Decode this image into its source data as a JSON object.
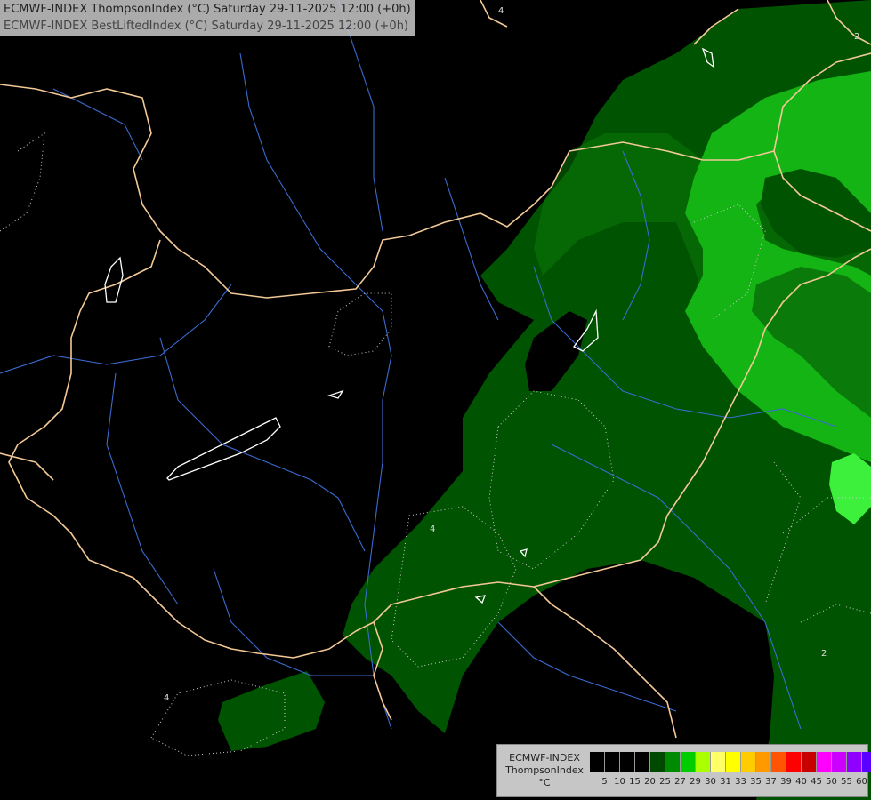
{
  "title": {
    "line1": "ECMWF-INDEX ThompsonIndex (°C) Saturday 29-11-2025 12:00 (+0h)",
    "line2": "ECMWF-INDEX BestLiftedIndex (°C) Saturday 29-11-2025 12:00 (+0h)"
  },
  "legend": {
    "label_lines": [
      "ECMWF-INDEX",
      "ThompsonIndex",
      "°C"
    ],
    "ticks": [
      "5",
      "10",
      "15",
      "20",
      "25",
      "27",
      "29",
      "30",
      "31",
      "33",
      "35",
      "37",
      "39",
      "40",
      "45",
      "50",
      "55",
      "60"
    ],
    "colors": [
      "#000000",
      "#000000",
      "#000000",
      "#000000",
      "#004a00",
      "#008a00",
      "#00cc00",
      "#aaff00",
      "#ffff66",
      "#ffff00",
      "#ffcc00",
      "#ff9900",
      "#ff5500",
      "#ff0000",
      "#c80000",
      "#ff00ff",
      "#cc00ff",
      "#9000ff",
      "#5a00ff",
      "#0000ff"
    ]
  },
  "contour_labels": {
    "top": "4",
    "top_right": "2",
    "center": "4",
    "bottom_right": "2",
    "bottom_left": "4"
  },
  "colors": {
    "dark_green": "#005300",
    "mid_green": "#0a7a0a",
    "bright_green": "#14b414",
    "lime": "#3cf03c",
    "borders": "#f2c896",
    "rivers": "#3b6bd0",
    "lakes": "#ffffff"
  }
}
